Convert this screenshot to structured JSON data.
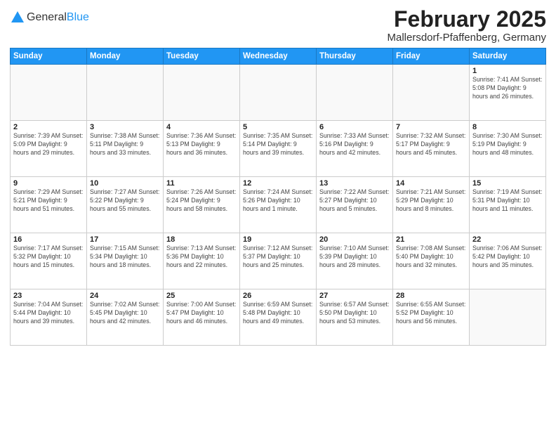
{
  "header": {
    "logo_general": "General",
    "logo_blue": "Blue",
    "month_title": "February 2025",
    "location": "Mallersdorf-Pfaffenberg, Germany"
  },
  "weekdays": [
    "Sunday",
    "Monday",
    "Tuesday",
    "Wednesday",
    "Thursday",
    "Friday",
    "Saturday"
  ],
  "weeks": [
    [
      {
        "day": "",
        "info": ""
      },
      {
        "day": "",
        "info": ""
      },
      {
        "day": "",
        "info": ""
      },
      {
        "day": "",
        "info": ""
      },
      {
        "day": "",
        "info": ""
      },
      {
        "day": "",
        "info": ""
      },
      {
        "day": "1",
        "info": "Sunrise: 7:41 AM\nSunset: 5:08 PM\nDaylight: 9 hours and 26 minutes."
      }
    ],
    [
      {
        "day": "2",
        "info": "Sunrise: 7:39 AM\nSunset: 5:09 PM\nDaylight: 9 hours and 29 minutes."
      },
      {
        "day": "3",
        "info": "Sunrise: 7:38 AM\nSunset: 5:11 PM\nDaylight: 9 hours and 33 minutes."
      },
      {
        "day": "4",
        "info": "Sunrise: 7:36 AM\nSunset: 5:13 PM\nDaylight: 9 hours and 36 minutes."
      },
      {
        "day": "5",
        "info": "Sunrise: 7:35 AM\nSunset: 5:14 PM\nDaylight: 9 hours and 39 minutes."
      },
      {
        "day": "6",
        "info": "Sunrise: 7:33 AM\nSunset: 5:16 PM\nDaylight: 9 hours and 42 minutes."
      },
      {
        "day": "7",
        "info": "Sunrise: 7:32 AM\nSunset: 5:17 PM\nDaylight: 9 hours and 45 minutes."
      },
      {
        "day": "8",
        "info": "Sunrise: 7:30 AM\nSunset: 5:19 PM\nDaylight: 9 hours and 48 minutes."
      }
    ],
    [
      {
        "day": "9",
        "info": "Sunrise: 7:29 AM\nSunset: 5:21 PM\nDaylight: 9 hours and 51 minutes."
      },
      {
        "day": "10",
        "info": "Sunrise: 7:27 AM\nSunset: 5:22 PM\nDaylight: 9 hours and 55 minutes."
      },
      {
        "day": "11",
        "info": "Sunrise: 7:26 AM\nSunset: 5:24 PM\nDaylight: 9 hours and 58 minutes."
      },
      {
        "day": "12",
        "info": "Sunrise: 7:24 AM\nSunset: 5:26 PM\nDaylight: 10 hours and 1 minute."
      },
      {
        "day": "13",
        "info": "Sunrise: 7:22 AM\nSunset: 5:27 PM\nDaylight: 10 hours and 5 minutes."
      },
      {
        "day": "14",
        "info": "Sunrise: 7:21 AM\nSunset: 5:29 PM\nDaylight: 10 hours and 8 minutes."
      },
      {
        "day": "15",
        "info": "Sunrise: 7:19 AM\nSunset: 5:31 PM\nDaylight: 10 hours and 11 minutes."
      }
    ],
    [
      {
        "day": "16",
        "info": "Sunrise: 7:17 AM\nSunset: 5:32 PM\nDaylight: 10 hours and 15 minutes."
      },
      {
        "day": "17",
        "info": "Sunrise: 7:15 AM\nSunset: 5:34 PM\nDaylight: 10 hours and 18 minutes."
      },
      {
        "day": "18",
        "info": "Sunrise: 7:13 AM\nSunset: 5:36 PM\nDaylight: 10 hours and 22 minutes."
      },
      {
        "day": "19",
        "info": "Sunrise: 7:12 AM\nSunset: 5:37 PM\nDaylight: 10 hours and 25 minutes."
      },
      {
        "day": "20",
        "info": "Sunrise: 7:10 AM\nSunset: 5:39 PM\nDaylight: 10 hours and 28 minutes."
      },
      {
        "day": "21",
        "info": "Sunrise: 7:08 AM\nSunset: 5:40 PM\nDaylight: 10 hours and 32 minutes."
      },
      {
        "day": "22",
        "info": "Sunrise: 7:06 AM\nSunset: 5:42 PM\nDaylight: 10 hours and 35 minutes."
      }
    ],
    [
      {
        "day": "23",
        "info": "Sunrise: 7:04 AM\nSunset: 5:44 PM\nDaylight: 10 hours and 39 minutes."
      },
      {
        "day": "24",
        "info": "Sunrise: 7:02 AM\nSunset: 5:45 PM\nDaylight: 10 hours and 42 minutes."
      },
      {
        "day": "25",
        "info": "Sunrise: 7:00 AM\nSunset: 5:47 PM\nDaylight: 10 hours and 46 minutes."
      },
      {
        "day": "26",
        "info": "Sunrise: 6:59 AM\nSunset: 5:48 PM\nDaylight: 10 hours and 49 minutes."
      },
      {
        "day": "27",
        "info": "Sunrise: 6:57 AM\nSunset: 5:50 PM\nDaylight: 10 hours and 53 minutes."
      },
      {
        "day": "28",
        "info": "Sunrise: 6:55 AM\nSunset: 5:52 PM\nDaylight: 10 hours and 56 minutes."
      },
      {
        "day": "",
        "info": ""
      }
    ]
  ]
}
